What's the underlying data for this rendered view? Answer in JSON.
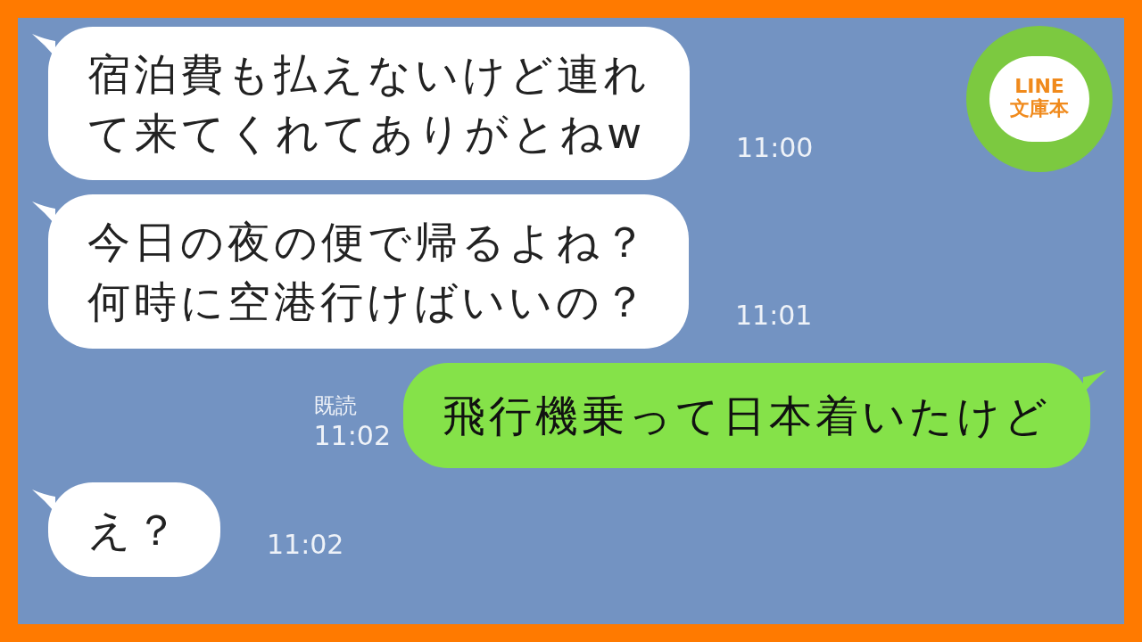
{
  "logo": {
    "line1": "LINE",
    "line2": "文庫本"
  },
  "messages": [
    {
      "kind": "incoming",
      "lines": [
        "宿泊費も払えないけど連れ",
        "て来てくれてありがとねw"
      ],
      "time": "11:00"
    },
    {
      "kind": "incoming",
      "lines": [
        "今日の夜の便で帰るよね？",
        "何時に空港行けばいいの？"
      ],
      "time": "11:01"
    },
    {
      "kind": "outgoing",
      "lines": [
        "飛行機乗って日本着いたけど"
      ],
      "read": "既読",
      "time": "11:02"
    },
    {
      "kind": "incoming",
      "lines": [
        "え？"
      ],
      "time": "11:02"
    }
  ]
}
